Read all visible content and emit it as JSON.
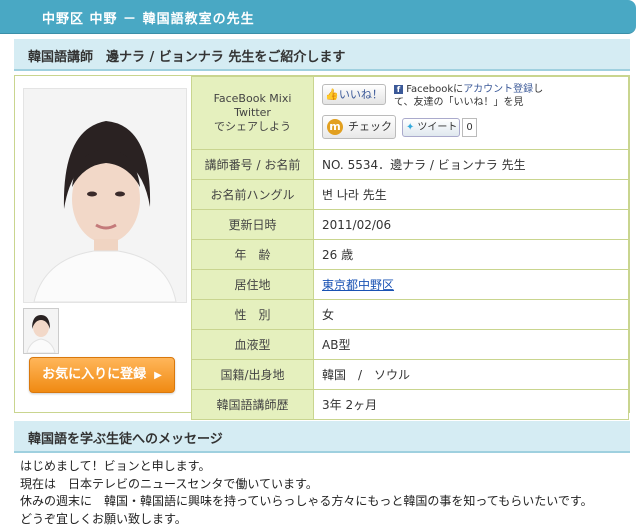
{
  "header": {
    "title": "中野区 中野 － 韓国語教室の先生"
  },
  "intro": {
    "title": "韓国語講師　邊ナラ / ビョンナラ 先生をご紹介します"
  },
  "share": {
    "label_line1": "FaceBook Mixi Twitter",
    "label_line2": "でシェアしよう",
    "like_label": "いいね！",
    "fb_text_prefix": "Facebookに",
    "fb_link": "アカウント登録",
    "fb_text_suffix": "し",
    "fb_text_line2": "て、友達の「いいね！」を見",
    "check_label": "チェック",
    "check_icon": "m",
    "tweet_label": "ツイート",
    "tweet_count": "0"
  },
  "profile": {
    "rows": [
      {
        "label": "講師番号 / お名前",
        "value": "NO. 5534．邊ナラ / ビョンナラ 先生"
      },
      {
        "label": "お名前ハングル",
        "value": "변 나라 先生"
      },
      {
        "label": "更新日時",
        "value": "2011/02/06"
      },
      {
        "label": "年　齢",
        "value": "26 歳"
      },
      {
        "label": "居住地",
        "value": "東京都中野区"
      },
      {
        "label": "性　別",
        "value": "女"
      },
      {
        "label": "血液型",
        "value": "AB型"
      },
      {
        "label": "国籍/出身地",
        "value": "韓国　/　ソウル"
      },
      {
        "label": "韓国語講師歴",
        "value": "3年 2ヶ月"
      }
    ]
  },
  "favorite": {
    "label": "お気に入りに登録",
    "arrow": "▶"
  },
  "message_section": {
    "title": "韓国語を学ぶ生徒へのメッセージ",
    "lines": [
      "はじめまして！ビョンと申します。",
      "現在は　日本テレビのニュースセンタで働いています。",
      "休みの週末に　韓国・韓国語に興味を持っていらっしゃる方々にもっと韓国の事を知ってもらいたいです。",
      "どうぞ宜しくお願い致します。"
    ]
  }
}
